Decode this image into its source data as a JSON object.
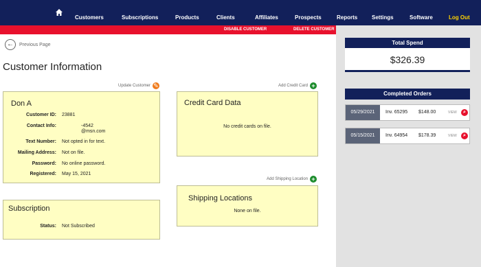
{
  "nav": {
    "home_icon": "home-icon",
    "items": [
      "Customers",
      "Subscriptions",
      "Products",
      "Clients",
      "Affiliates",
      "Prospects",
      "Reports",
      "Settings",
      "Software",
      "Log Out"
    ]
  },
  "actions": {
    "disable": "DISABLE CUSTOMER",
    "delete": "DELETE CUSTOMER"
  },
  "previous_page": "Previous Page",
  "page_title": "Customer Information",
  "update_customer": "Update Customer",
  "customer": {
    "name": "Don A",
    "fields": [
      {
        "label": "Customer ID:",
        "value": "23881"
      },
      {
        "label": "Contact Info:",
        "value": "-4542"
      },
      {
        "label": "Text Number:",
        "value": "Not opted in for text."
      },
      {
        "label": "Mailing Address:",
        "value": "Not on file."
      },
      {
        "label": "Password:",
        "value": "No online password."
      },
      {
        "label": "Registered:",
        "value": "May 15, 2021"
      }
    ],
    "email": "@msn.com"
  },
  "subscription": {
    "heading": "Subscription",
    "status_label": "Status:",
    "status_value": "Not Subscribed"
  },
  "credit_card": {
    "add_link": "Add Credit Card",
    "heading": "Credit Card Data",
    "empty": "No credit cards on file."
  },
  "shipping": {
    "add_link": "Add Shipping Location",
    "heading": "Shipping Locations",
    "empty": "None on file."
  },
  "sidebar": {
    "total_spend_title": "Total Spend",
    "total_spend": "$326.39",
    "completed_orders_title": "Completed Orders",
    "orders": [
      {
        "date": "05/29/2021",
        "invoice": "Inv. 65295",
        "amount": "$148.00",
        "view": "VIEW"
      },
      {
        "date": "05/15/2021",
        "invoice": "Inv. 64954",
        "amount": "$178.39",
        "view": "VIEW"
      }
    ]
  },
  "colors": {
    "nav_bg": "#12205a",
    "action_bar": "#e8112d",
    "logout": "#ffd200",
    "card_bg": "#fffec3",
    "sidebar_bg": "#e2e2e2"
  }
}
